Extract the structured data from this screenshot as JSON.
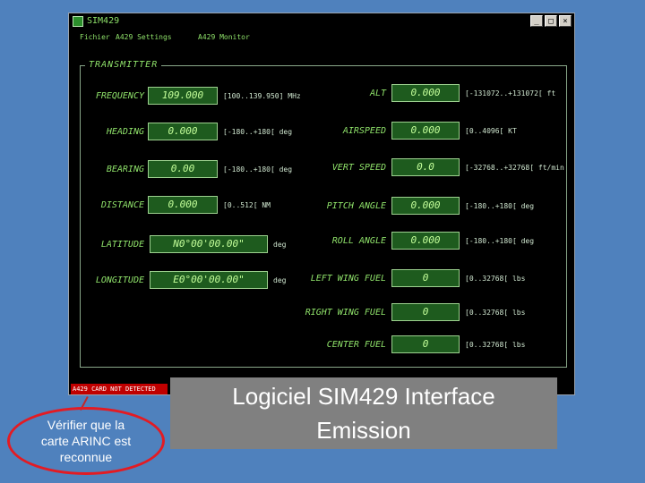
{
  "window": {
    "title": "SIM429",
    "buttons": {
      "minimize": "_",
      "maximize": "□",
      "close": "×"
    }
  },
  "menu": {
    "items": [
      "Fichier",
      "A429 Settings",
      "A429 Monitor"
    ]
  },
  "group_title": "TRANSMITTER",
  "left_fields": [
    {
      "label": "FREQUENCY",
      "value": "109.000",
      "range": "[100..139.950] MHz"
    },
    {
      "label": "HEADING",
      "value": "0.000",
      "range": "[-180..+180[ deg"
    },
    {
      "label": "BEARING",
      "value": "0.00",
      "range": "[-180..+180[ deg"
    },
    {
      "label": "DISTANCE",
      "value": "0.000",
      "range": "[0..512[ NM"
    },
    {
      "label": "LATITUDE",
      "value": "N0°00'00.00\"",
      "range": "deg"
    },
    {
      "label": "LONGITUDE",
      "value": "E0°00'00.00\"",
      "range": "deg"
    }
  ],
  "right_fields": [
    {
      "label": "ALT",
      "value": "0.000",
      "range": "[-131072..+131072[ ft"
    },
    {
      "label": "AIRSPEED",
      "value": "0.000",
      "range": "[0..4096[ KT"
    },
    {
      "label": "VERT SPEED",
      "value": "0.0",
      "range": "[-32768..+32768[ ft/min"
    },
    {
      "label": "PITCH ANGLE",
      "value": "0.000",
      "range": "[-180..+180[ deg"
    },
    {
      "label": "ROLL ANGLE",
      "value": "0.000",
      "range": "[-180..+180[ deg"
    },
    {
      "label": "LEFT WING FUEL",
      "value": "0",
      "range": "[0..32768[ lbs"
    },
    {
      "label": "RIGHT WING FUEL",
      "value": "0",
      "range": "[0..32768[ lbs"
    },
    {
      "label": "CENTER FUEL",
      "value": "0",
      "range": "[0..32768[ lbs"
    }
  ],
  "status": "A429 CARD NOT DETECTED",
  "callout": "Vérifier que la carte ARINC est reconnue",
  "caption": "Logiciel SIM429 Interface Emission",
  "colors": {
    "background": "#4f81bd",
    "window": "#000000",
    "text": "#8fe26a",
    "field": "#1e5b1e",
    "status": "#c00000",
    "callout_border": "#e31b23",
    "caption_bg": "#808080"
  }
}
